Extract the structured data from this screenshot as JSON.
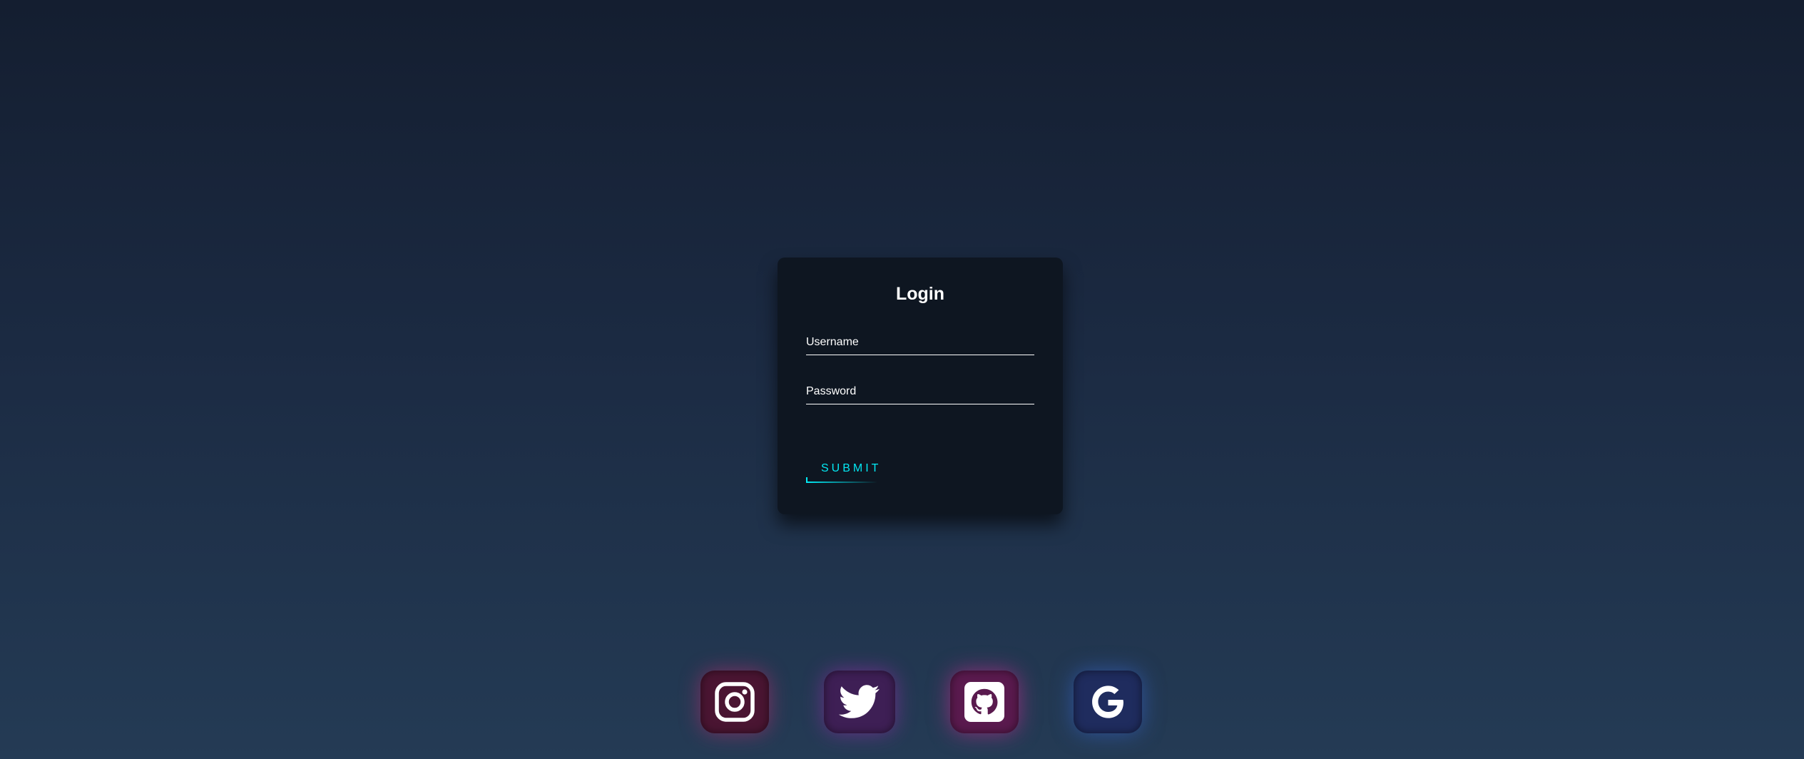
{
  "login": {
    "title": "Login",
    "username": {
      "label": "Username",
      "value": ""
    },
    "password": {
      "label": "Password",
      "value": ""
    },
    "submit_label": "SUBMIT"
  },
  "socials": [
    {
      "name": "Instagram",
      "icon": "instagram-icon",
      "color": "#4a1532"
    },
    {
      "name": "Twitter",
      "icon": "twitter-icon",
      "color": "#3e1f55"
    },
    {
      "name": "GitHub",
      "icon": "github-icon",
      "color": "#5a1a4e"
    },
    {
      "name": "Google",
      "icon": "google-icon",
      "color": "#1f2c5e"
    }
  ],
  "colors": {
    "background_top": "#141e30",
    "background_bottom": "#243b55",
    "card": "#0e1621",
    "accent": "#03e9f4"
  }
}
